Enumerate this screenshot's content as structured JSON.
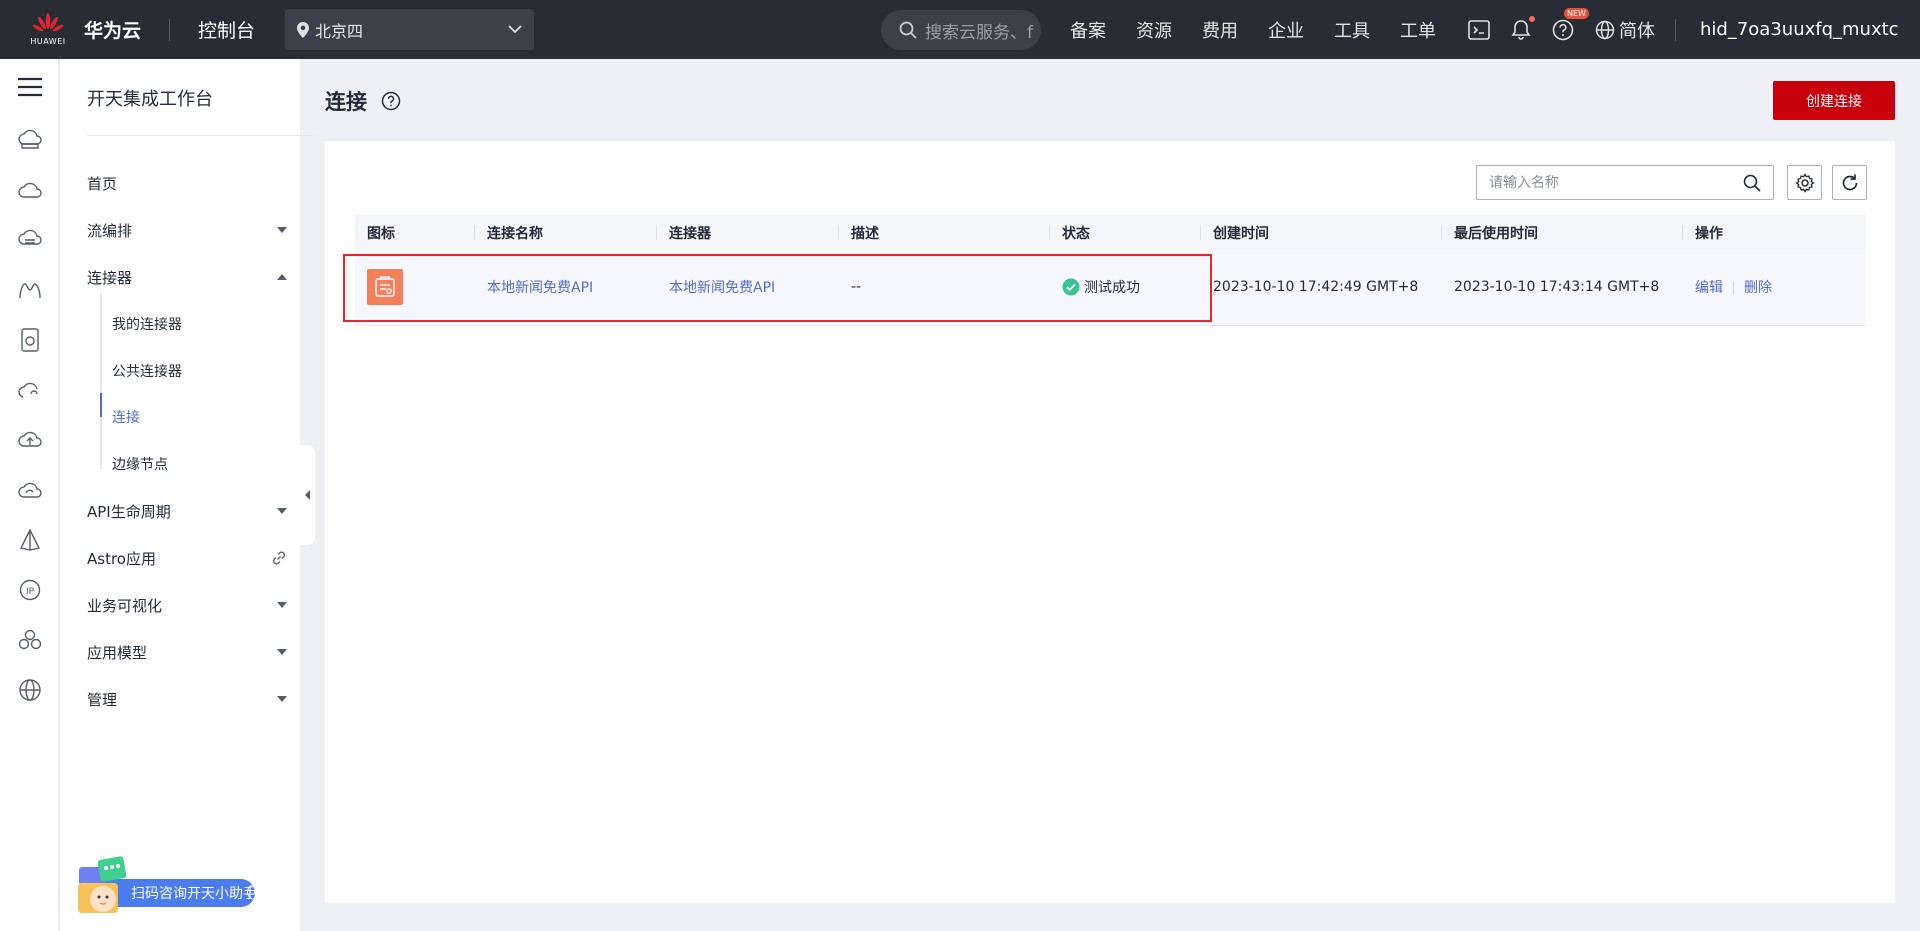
{
  "topbar": {
    "logo_text": "HUAWEI",
    "brand": "华为云",
    "console": "控制台",
    "region": "北京四",
    "search_placeholder": "搜索云服务、f",
    "nav": [
      "备案",
      "资源",
      "费用",
      "企业",
      "工具",
      "工单"
    ],
    "new_badge": "NEW",
    "language": "简体",
    "username": "hid_7oa3uuxfq_muxtc"
  },
  "sidebar": {
    "title": "开天集成工作台",
    "items": {
      "home": "首页",
      "flow": "流编排",
      "connector": "连接器",
      "my_connector": "我的连接器",
      "public_connector": "公共连接器",
      "connection": "连接",
      "edge_node": "边缘节点",
      "api_lifecycle": "API生命周期",
      "astro": "Astro应用",
      "biz_visual": "业务可视化",
      "app_model": "应用模型",
      "manage": "管理"
    },
    "assistant": "扫码咨询开天小助手"
  },
  "main": {
    "title": "连接",
    "create_button": "创建连接",
    "filter_placeholder": "请输入名称",
    "columns": [
      "图标",
      "连接名称",
      "连接器",
      "描述",
      "状态",
      "创建时间",
      "最后使用时间",
      "操作"
    ],
    "rows": [
      {
        "name": "本地新闻免费API",
        "connector": "本地新闻免费API",
        "description": "--",
        "status": "测试成功",
        "created": "2023-10-10 17:42:49 GMT+8",
        "last_used": "2023-10-10 17:43:14 GMT+8",
        "edit": "编辑",
        "delete": "删除"
      }
    ]
  },
  "colors": {
    "topbar_bg": "#272c35",
    "accent_link": "#526ecc",
    "primary_button": "#c7000b",
    "success": "#3ac295",
    "connector_icon": "#f57f5b",
    "highlight_border": "#e8262b"
  }
}
